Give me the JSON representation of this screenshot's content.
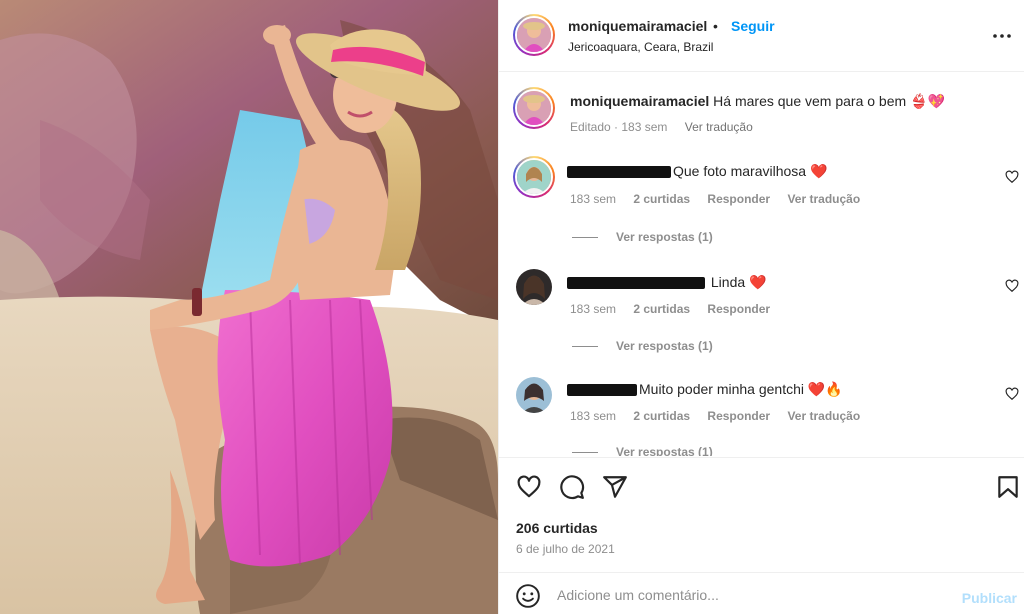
{
  "post": {
    "username": "moniquemairamaciel",
    "separator": "•",
    "follow_label": "Seguir",
    "location": "Jericoaquara, Ceara, Brazil",
    "caption": {
      "username": "moniquemairamaciel",
      "text": "Há mares que vem para o bem",
      "emoji": "👙💖",
      "edited": "Editado · 183 sem",
      "translate": "Ver tradução"
    },
    "likes": "206 curtidas",
    "date": "6 de julho de 2021"
  },
  "comments": [
    {
      "text": "Que foto maravilhosa",
      "emoji": "❤️",
      "time": "183 sem",
      "likes": "2 curtidas",
      "reply": "Responder",
      "translate": "Ver tradução",
      "view_replies": "Ver respostas (1)"
    },
    {
      "text": "Linda",
      "emoji": "❤️",
      "time": "183 sem",
      "likes": "2 curtidas",
      "reply": "Responder",
      "view_replies": "Ver respostas (1)"
    },
    {
      "text": "Muito poder minha gentchi",
      "emoji": "❤️🔥",
      "time": "183 sem",
      "likes": "2 curtidas",
      "reply": "Responder",
      "translate": "Ver tradução",
      "view_replies": "Ver respostas (1)"
    }
  ],
  "add_comment": {
    "placeholder": "Adicione um comentário...",
    "post_label": "Publicar"
  },
  "icons": {
    "more": "more-icon",
    "like": "heart-icon",
    "comment": "comment-icon",
    "share": "share-icon",
    "save": "bookmark-icon",
    "emoji": "emoji-icon"
  },
  "colors": {
    "link": "#0095f6",
    "muted": "#8e8e8e",
    "text": "#262626",
    "publish_disabled": "#b2dffc",
    "heart": "#ed1c24"
  }
}
